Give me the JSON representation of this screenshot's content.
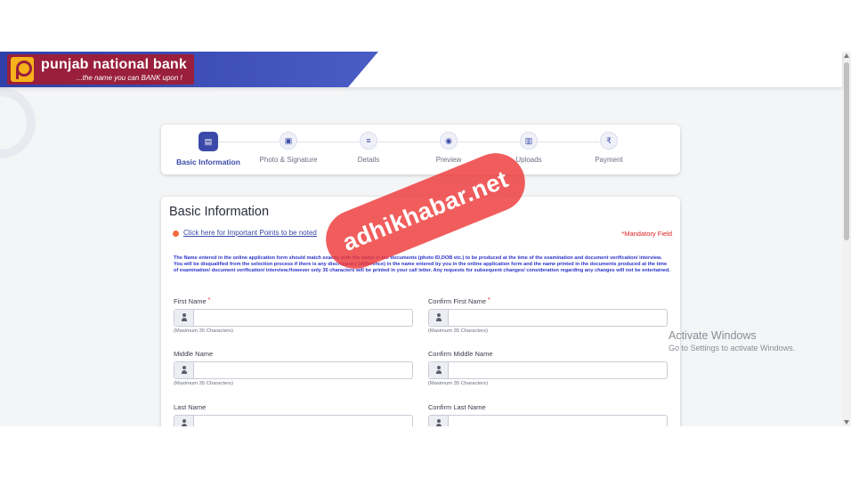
{
  "header": {
    "bank_name": "punjab national bank",
    "tagline": "...the name you can BANK upon !"
  },
  "steps": [
    {
      "label": "Basic Information",
      "icon": "id-card-icon",
      "glyph": "▤",
      "active": true
    },
    {
      "label": "Photo & Signature",
      "icon": "image-icon",
      "glyph": "▣",
      "active": false
    },
    {
      "label": "Details",
      "icon": "document-icon",
      "glyph": "≡",
      "active": false
    },
    {
      "label": "Preview",
      "icon": "eye-icon",
      "glyph": "◉",
      "active": false
    },
    {
      "label": "Uploads",
      "icon": "upload-file-icon",
      "glyph": "▥",
      "active": false
    },
    {
      "label": "Payment",
      "icon": "rupee-icon",
      "glyph": "₹",
      "active": false
    }
  ],
  "form": {
    "title": "Basic Information",
    "note_link": "Click here for Important Points to be noted",
    "mandatory": "*Mandatory Field",
    "instruction": "The Name entered in the online application form should match exactly with the name in the documents (photo ID,DOB etc.) to be produced at the time of the examination and document verification/ interview. You will be disqualified from the selection process if there is any discrepancy (difference) in the name entered by you in the online application form and the name printed in the documents produced at the time of examination/ document verification/ interview.However only 35 characters will be printed in your call letter. Any requests for subsequent changes/ consideration regarding any changes will not be entertained.",
    "fields": {
      "first_name": {
        "label": "First Name",
        "required": "*",
        "hint": "(Maximum 35 Characters)",
        "value": ""
      },
      "confirm_first_name": {
        "label": "Confirm First Name",
        "required": "*",
        "hint": "(Maximum 35 Characters)",
        "value": ""
      },
      "middle_name": {
        "label": "Middle Name",
        "hint": "(Maximum 35 Characters)",
        "value": ""
      },
      "confirm_middle_name": {
        "label": "Confirm Middle Name",
        "hint": "(Maximum 35 Characters)",
        "value": ""
      },
      "last_name": {
        "label": "Last Name",
        "value": ""
      },
      "confirm_last_name": {
        "label": "Confirm Last Name",
        "value": ""
      }
    }
  },
  "os_overlay": {
    "title": "Activate Windows",
    "subtitle": "Go to Settings to activate Windows."
  },
  "watermark": "adhikhabar.net",
  "colors": {
    "brand_maroon": "#9a1f3c",
    "brand_gold": "#f5b21a",
    "accent_blue": "#3b4aa8",
    "required_red": "#e02020",
    "instruction_blue": "#2b33c9"
  }
}
